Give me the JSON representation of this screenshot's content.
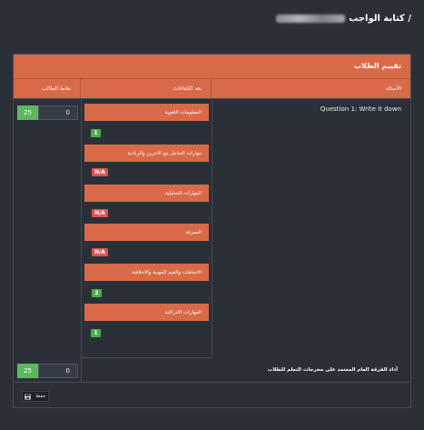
{
  "page": {
    "title": "كتابة الواجب /"
  },
  "card": {
    "title": "تقييم الطلاب",
    "columns": {
      "questions": "الأسئلة",
      "competencies": "بعد الكفاءات",
      "student_points": "نقاط الطالب"
    }
  },
  "question": {
    "label": "Question 1: Write it down",
    "competencies": [
      {
        "label": "المعلومات اللغوية",
        "badge": "1",
        "badge_color": "#4cae4c"
      },
      {
        "label": "مهارات التعامل مع الاخرين والريادية",
        "badge": "N/A",
        "badge_color": "#d9534f"
      },
      {
        "label": "المهارات التحليلية",
        "badge": "N/A",
        "badge_color": "#d9534f"
      },
      {
        "label": "المعرفة",
        "badge": "N/A",
        "badge_color": "#d9534f"
      },
      {
        "label": "الاتجاهات والقيم المهنية والاخلاقية",
        "badge": "2",
        "badge_color": "#4cae4c"
      },
      {
        "label": "المهارات الادراكية",
        "badge": "1",
        "badge_color": "#4cae4c"
      }
    ],
    "score": {
      "value": "0",
      "max": "25"
    }
  },
  "footer": {
    "label": "أداء الفرقة العام المعتمد على مخرجات التعلم للطلاب",
    "score": {
      "value": "0",
      "max": "25"
    }
  },
  "actions": {
    "save_label": "حفظ",
    "save_icon": "floppy-disk-icon"
  },
  "colors": {
    "accent": "#d96a49",
    "success": "#5cb85c",
    "danger": "#d9534f",
    "background": "#2b3038"
  }
}
